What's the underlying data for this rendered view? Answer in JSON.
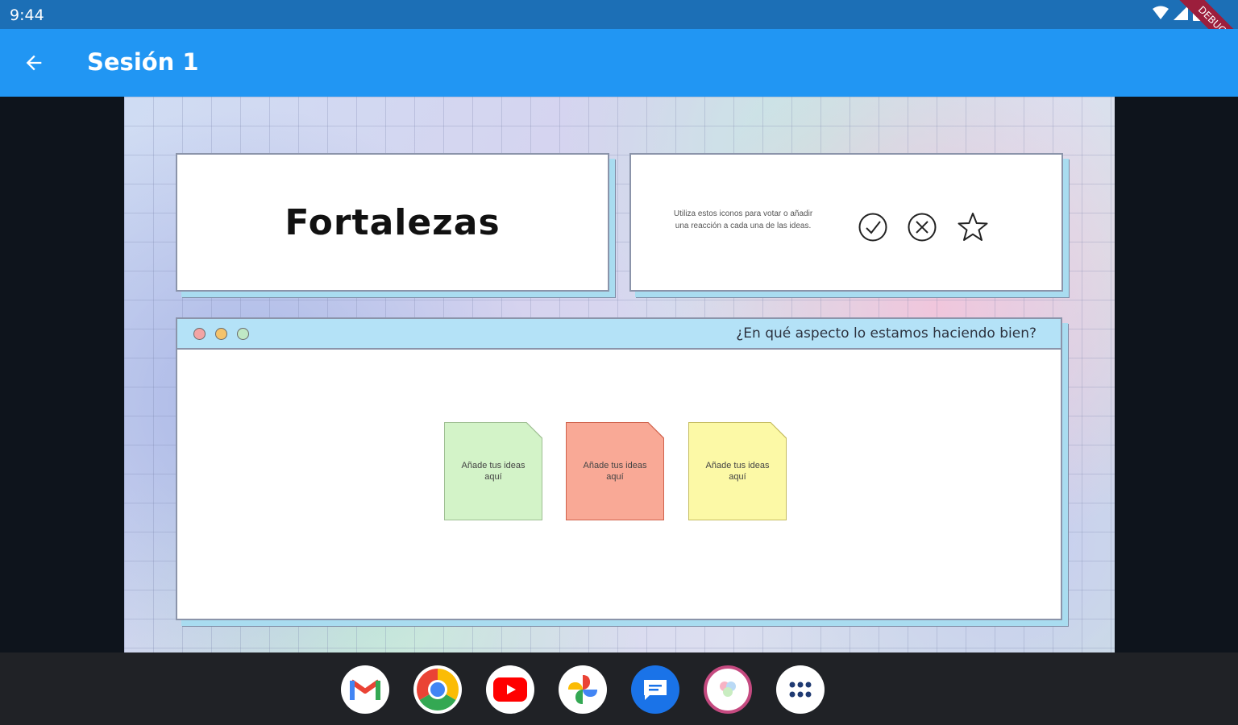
{
  "status_bar": {
    "time": "9:44",
    "debug_label": "DEBUG"
  },
  "app_bar": {
    "title": "Sesión 1",
    "back_icon": "arrow-back-icon"
  },
  "board": {
    "title": "Fortalezas",
    "legend": {
      "text": "Utiliza estos iconos para votar o añadir una reacción a cada una de las ideas.",
      "icons": [
        "check-circle-icon",
        "x-circle-icon",
        "star-icon"
      ]
    },
    "window": {
      "question": "¿En qué aspecto lo estamos haciendo bien?",
      "dot_colors": [
        "#f2a4a4",
        "#f5c36b",
        "#bfe8c5"
      ]
    },
    "notes": [
      {
        "text": "Añade tus ideas aquí",
        "color": "#d3f3c8",
        "border": "#9fbf93"
      },
      {
        "text": "Añade tus ideas aquí",
        "color": "#f9a996",
        "border": "#d0634d"
      },
      {
        "text": "Añade tus ideas aquí",
        "color": "#fcf9a6",
        "border": "#c6bd62"
      }
    ]
  },
  "dock": {
    "apps": [
      "gmail-icon",
      "chrome-icon",
      "youtube-icon",
      "photos-icon",
      "messages-icon",
      "app-icon",
      "app-drawer-icon"
    ]
  }
}
